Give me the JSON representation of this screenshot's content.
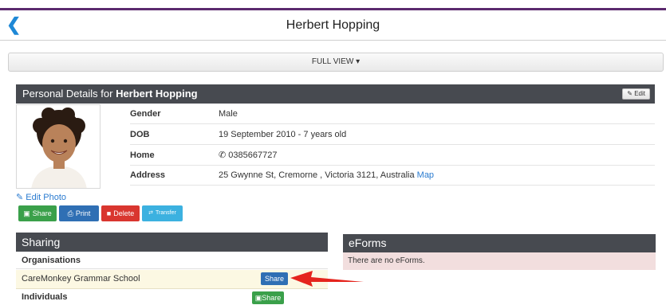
{
  "header": {
    "title": "Herbert Hopping",
    "back_icon": "chevron-left-icon"
  },
  "view": {
    "label": "FULL VIEW ▾"
  },
  "personal": {
    "heading_prefix": "Personal Details for ",
    "heading_name": "Herbert Hopping",
    "edit_label": "Edit",
    "fields": [
      {
        "label": "Gender",
        "value": "Male"
      },
      {
        "label": "DOB",
        "value": "19 September 2010 - 7 years old"
      },
      {
        "label": "Home",
        "value": "0385667727"
      },
      {
        "label": "Address",
        "value": "25 Gwynne St, Cremorne , Victoria 3121, Australia",
        "link": "Map"
      }
    ],
    "edit_photo": "Edit Photo"
  },
  "actions": {
    "share": "Share",
    "print": "Print",
    "delete": "Delete",
    "transfer": "Transfer"
  },
  "sharing": {
    "title": "Sharing",
    "organisations_label": "Organisations",
    "school": "CareMonkey Grammar School",
    "share_button": "Share",
    "individuals_label": "Individuals",
    "individual_share": "Share"
  },
  "eforms": {
    "title": "eForms",
    "message": "There are no eForms."
  },
  "colors": {
    "accent": "#2a7bd0",
    "header_bar": "#474a50",
    "top_line": "#5b2a6e",
    "annotation_arrow": "#e5241d"
  }
}
